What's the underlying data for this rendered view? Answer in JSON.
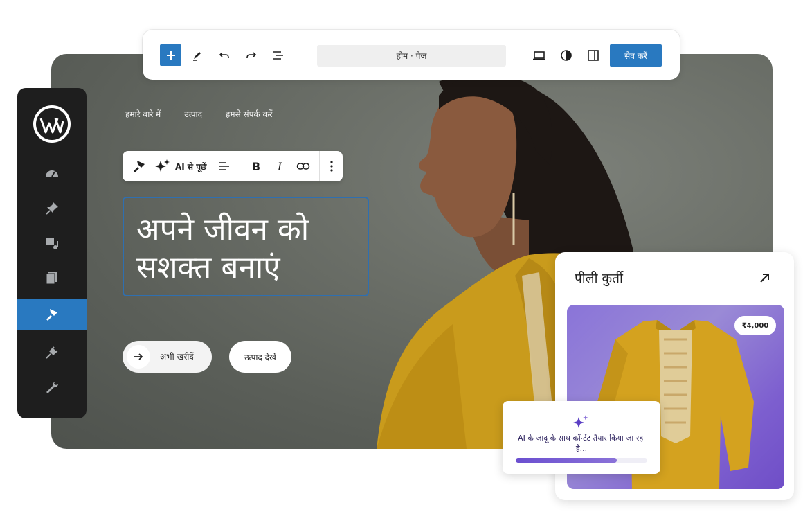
{
  "toolbar": {
    "breadcrumb": "होम · पेज",
    "save_label": "सेव करें"
  },
  "nav": {
    "items": [
      "हमारे बारे में",
      "उत्पाद",
      "हमसे संपर्क करें"
    ]
  },
  "block_toolbar": {
    "ai_label": "AI से पूछें",
    "bold": "B",
    "italic": "I"
  },
  "hero": {
    "heading": "अपने जीवन को सशक्त बनाएं",
    "buy_label": "अभी खरीदें",
    "view_label": "उत्पाद देखें"
  },
  "product": {
    "title": "पीली कुर्ती",
    "price": "₹4,000"
  },
  "ai_popup": {
    "text": "AI के जादू के साथ कॉन्टेंट तैयार किया जा रहा है...",
    "progress": 0.77
  },
  "colors": {
    "accent": "#2979c0",
    "sidebar": "#1e1e1e",
    "ai_purple": "#6b4fd0"
  }
}
